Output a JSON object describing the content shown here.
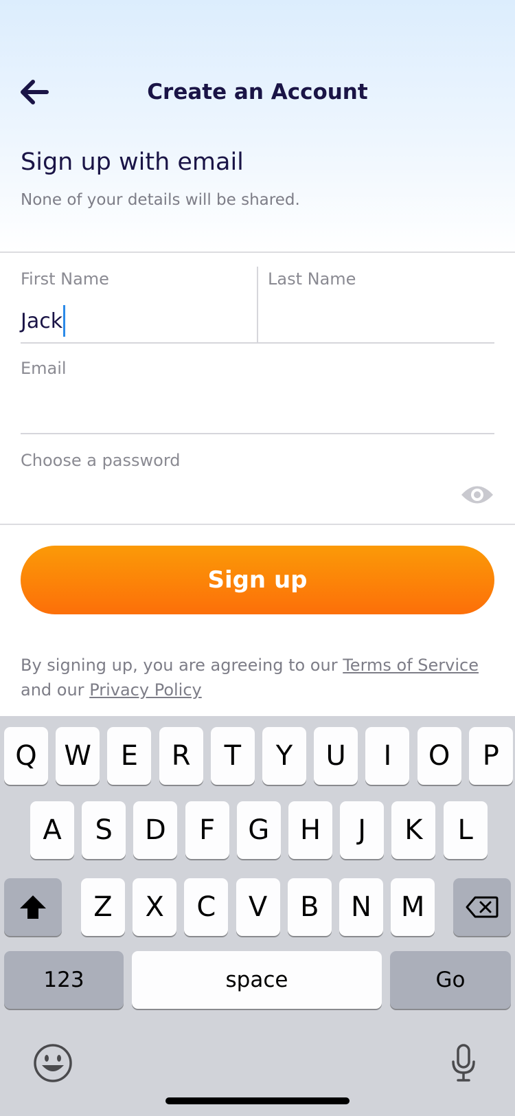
{
  "header": {
    "title": "Create an Account"
  },
  "intro": {
    "title": "Sign up with email",
    "subtitle": "None of your details will be shared."
  },
  "form": {
    "first_name": {
      "label": "First Name",
      "value": "Jack"
    },
    "last_name": {
      "label": "Last Name",
      "value": ""
    },
    "email": {
      "label": "Email",
      "value": ""
    },
    "password": {
      "label": "Choose a password",
      "value": ""
    }
  },
  "signup_button": {
    "label": "Sign up"
  },
  "legal": {
    "prefix": "By signing up, you are agreeing to our",
    "terms_link": "Terms of Service",
    "middle": "and our",
    "privacy_link": "Privacy Policy"
  },
  "keyboard": {
    "row1": [
      "Q",
      "W",
      "E",
      "R",
      "T",
      "Y",
      "U",
      "I",
      "O",
      "P"
    ],
    "row2": [
      "A",
      "S",
      "D",
      "F",
      "G",
      "H",
      "J",
      "K",
      "L"
    ],
    "row3": [
      "Z",
      "X",
      "C",
      "V",
      "B",
      "N",
      "M"
    ],
    "numbers_key": "123",
    "space_key": "space",
    "go_key": "Go"
  },
  "icons": {
    "back": "arrow-left-icon",
    "eye": "eye-icon",
    "shift": "shift-icon",
    "backspace": "backspace-icon",
    "emoji": "emoji-icon",
    "microphone": "microphone-icon"
  },
  "colors": {
    "accent": "#fc7c09",
    "text_primary": "#1a1446",
    "caret": "#2b8ae8"
  }
}
